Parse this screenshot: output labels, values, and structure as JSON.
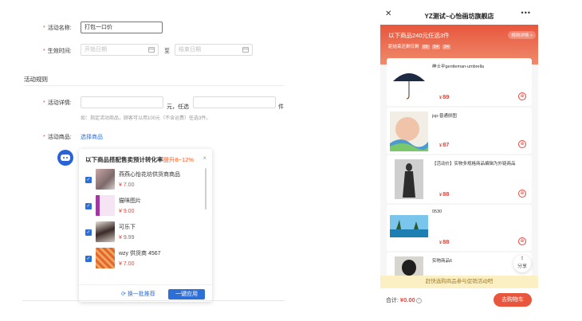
{
  "form": {
    "name_label": "活动名称:",
    "name_value": "打包一口价",
    "time_label": "生效时间:",
    "start_placeholder": "开始日期",
    "to_label": "至",
    "end_placeholder": "结束日期",
    "rules_section": "活动规则",
    "detail_label": "活动详情:",
    "yuan_pick": "元，任选",
    "pieces": "件",
    "detail_hint": "如：指定活动商品，顾客可以用100元（不含运费）任选3件。",
    "goods_label": "活动商品:",
    "select_goods": "选择商品"
  },
  "popup": {
    "title": "以下商品搭配售卖预计转化率",
    "highlight": "提升8~12%",
    "close": "×",
    "items": [
      {
        "name": "燕燕心怡花坊供货商商品",
        "price": "¥ 7.00"
      },
      {
        "name": "猫咪图片",
        "price": "¥ 9.00"
      },
      {
        "name": "可乐下",
        "price": "¥ 9.99"
      },
      {
        "name": "wzy 供货商 4567",
        "price": "¥ 7.00"
      }
    ],
    "refresh": "换一批推荐",
    "apply": "一键应用"
  },
  "phone": {
    "title": "YZ测试~心怡画坊旗舰店",
    "banner_title": "以下商品240元任选3件",
    "rule_btn": "规则详情 >",
    "countdown_label": "距结束还剩仅剩",
    "countdown": [
      "09",
      "54",
      "34"
    ],
    "products": [
      {
        "name": "绅士伞gentleman-umbrella",
        "price": "89"
      },
      {
        "name": "jsp-普通拼图",
        "price": "87"
      },
      {
        "name": "【活动价】实物多规格商品编辑为外链商品",
        "price": "88"
      },
      {
        "name": "0530",
        "price": "88"
      },
      {
        "name": "实物商品6",
        "price": ""
      }
    ],
    "currency": "¥",
    "share": "分享",
    "tip": "赶快选购商品参与促销活动吧",
    "total_label": "合计:",
    "total_amount": "¥0.00",
    "cart_btn": "去购物车"
  },
  "colors": {
    "accent": "#2d6fd6",
    "brand": "#e8563d",
    "price": "#e8453c"
  }
}
